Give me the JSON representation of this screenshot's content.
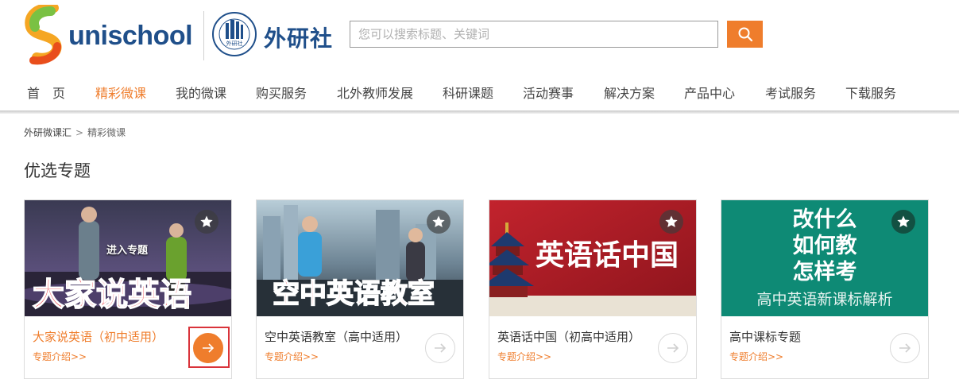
{
  "brand": {
    "logo_text": "unischool",
    "publisher_name": "外研社",
    "seal_label": "外研社"
  },
  "search": {
    "placeholder": "您可以搜索标题、关键词",
    "value": ""
  },
  "nav": {
    "items": [
      {
        "label": "首　页",
        "active": false
      },
      {
        "label": "精彩微课",
        "active": true
      },
      {
        "label": "我的微课",
        "active": false
      },
      {
        "label": "购买服务",
        "active": false
      },
      {
        "label": "北外教师发展",
        "active": false
      },
      {
        "label": "科研课题",
        "active": false
      },
      {
        "label": "活动赛事",
        "active": false
      },
      {
        "label": "解决方案",
        "active": false
      },
      {
        "label": "产品中心",
        "active": false
      },
      {
        "label": "考试服务",
        "active": false
      },
      {
        "label": "下载服务",
        "active": false
      }
    ]
  },
  "breadcrumb": {
    "root": "外研微课汇",
    "separator": ">",
    "current": "精彩微课"
  },
  "section": {
    "title": "优选专题"
  },
  "cards": [
    {
      "banner": "大家说英语",
      "overlay_label": "进入专题",
      "title": "大家说英语（初中适用）",
      "link": "专题介绍>>",
      "highlighted": true
    },
    {
      "banner": "空中英语教室",
      "title": "空中英语教室（高中适用）",
      "link": "专题介绍>>",
      "highlighted": false
    },
    {
      "banner": "英语话中国",
      "title": "英语话中国（初高中适用）",
      "link": "专题介绍>>",
      "highlighted": false
    },
    {
      "banner_lines": [
        "改什么",
        "如何教",
        "怎样考"
      ],
      "banner_sub": "高中英语新课标解析",
      "title": "高中课标专题",
      "link": "专题介绍>>",
      "highlighted": false
    }
  ],
  "colors": {
    "accent": "#ef7d2c",
    "brand_blue": "#1f4f8a",
    "highlight_border": "#d9333a",
    "card4_bg": "#0e8a75",
    "card3_bg": "#b3202a"
  }
}
